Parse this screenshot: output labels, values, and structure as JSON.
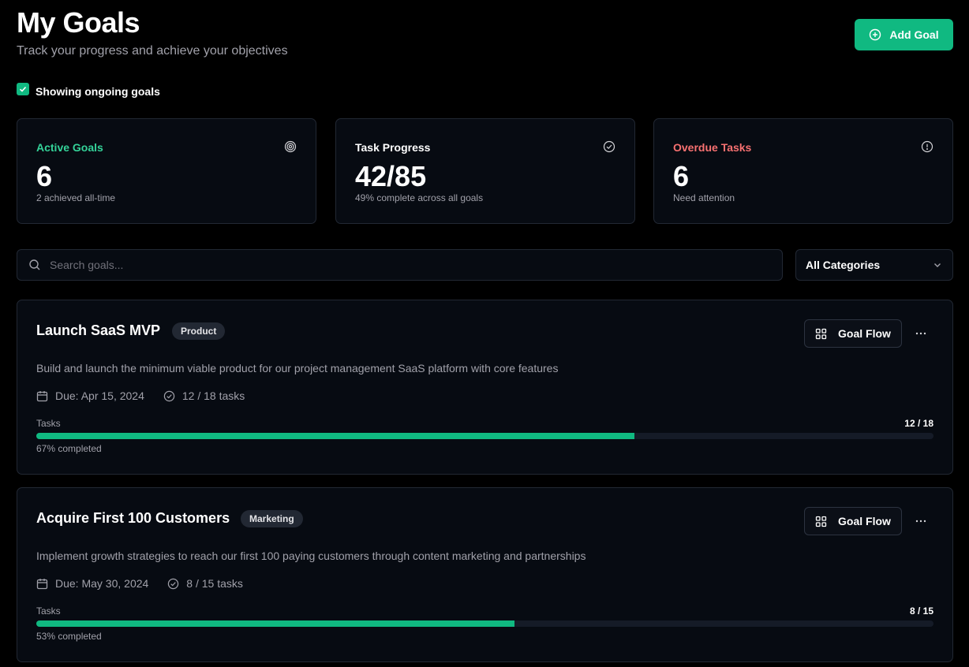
{
  "header": {
    "title": "My Goals",
    "subtitle": "Track your progress and achieve your objectives",
    "add_button_label": "Add Goal"
  },
  "filter": {
    "label": "Showing ongoing goals",
    "checked": true
  },
  "stats": [
    {
      "label": "Active Goals",
      "value": "6",
      "sub": "2 achieved all-time",
      "color": "#34d399",
      "icon": "target-icon"
    },
    {
      "label": "Task Progress",
      "value": "42/85",
      "sub": "49% complete across all goals",
      "color": "#ffffff",
      "icon": "check-circle-icon"
    },
    {
      "label": "Overdue Tasks",
      "value": "6",
      "sub": "Need attention",
      "color": "#f87171",
      "icon": "alert-circle-icon"
    }
  ],
  "search": {
    "placeholder": "Search goals..."
  },
  "category_select": {
    "selected": "All Categories"
  },
  "goals": [
    {
      "title": "Launch SaaS MVP",
      "tag": "Product",
      "flow_label": "Goal Flow",
      "description": "Build and launch the minimum viable product for our project management SaaS platform with core features",
      "due": "Due: Apr 15, 2024",
      "tasks_summary": "12 / 18 tasks",
      "tasks_label": "Tasks",
      "tasks_count": "12 / 18",
      "progress": 0.667,
      "completed_text": "67% completed"
    },
    {
      "title": "Acquire First 100 Customers",
      "tag": "Marketing",
      "flow_label": "Goal Flow",
      "description": "Implement growth strategies to reach our first 100 paying customers through content marketing and partnerships",
      "due": "Due: May 30, 2024",
      "tasks_summary": "8 / 15 tasks",
      "tasks_label": "Tasks",
      "tasks_count": "8 / 15",
      "progress": 0.533,
      "completed_text": "53% completed"
    }
  ],
  "colors": {
    "accent": "#10b981",
    "background": "#000000",
    "card": "#070b12",
    "border": "#222833"
  }
}
